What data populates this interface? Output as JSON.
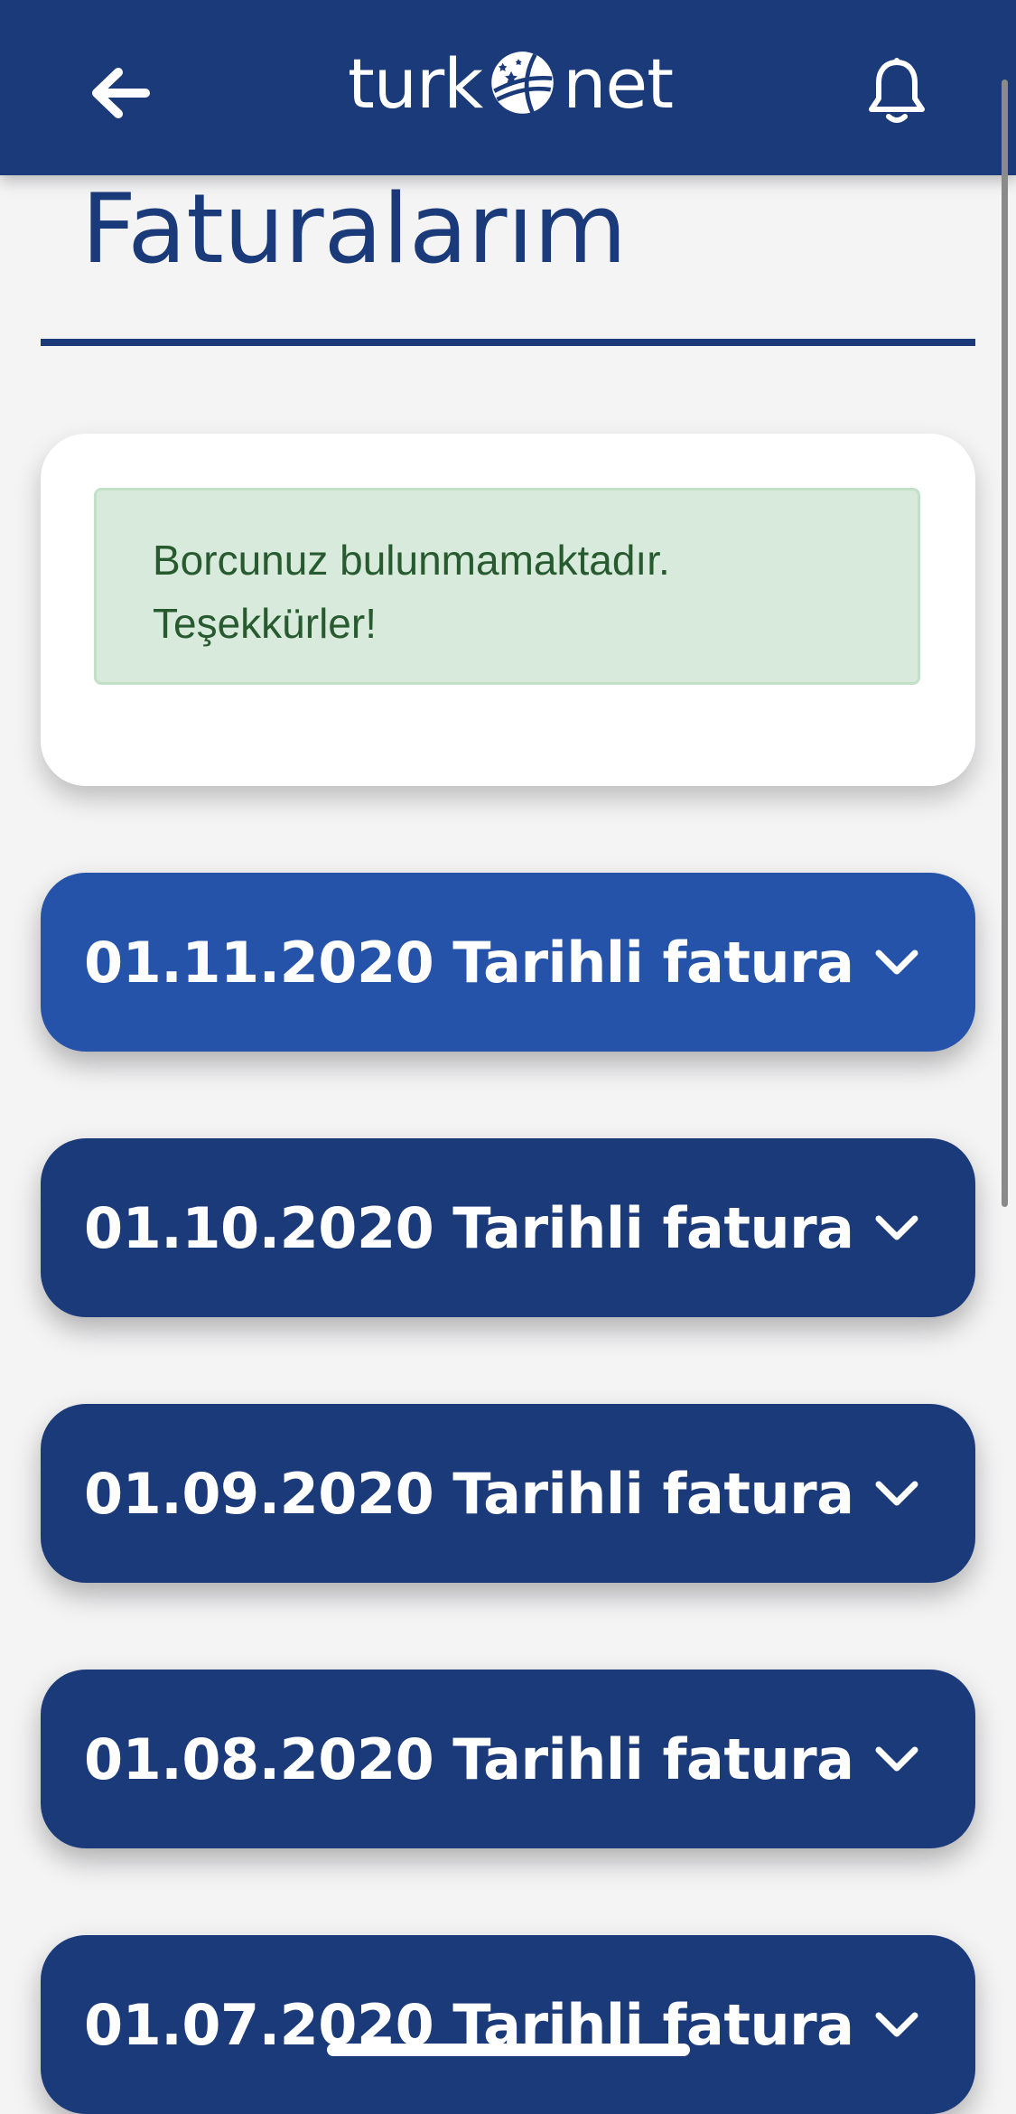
{
  "header": {
    "logo_left": "turk",
    "logo_right": "net",
    "back_icon": "arrow-left-icon",
    "notification_icon": "bell-icon",
    "background_color": "#1b3a7a"
  },
  "page": {
    "title": "Faturalarım"
  },
  "balance_card": {
    "message_line1": "Borcunuz bulunmamaktadır.",
    "message_line2": "Teşekkürler!"
  },
  "invoices": [
    {
      "label": "01.11.2020 Tarihli fatura",
      "active": true
    },
    {
      "label": "01.10.2020 Tarihli fatura",
      "active": false
    },
    {
      "label": "01.09.2020 Tarihli fatura",
      "active": false
    },
    {
      "label": "01.08.2020 Tarihli fatura",
      "active": false
    },
    {
      "label": "01.07.2020 Tarihli fatura",
      "active": false
    }
  ],
  "colors": {
    "primary": "#1b3a7a",
    "active": "#2553a9",
    "success_bg": "#d8eadb",
    "success_text": "#275a2f"
  }
}
